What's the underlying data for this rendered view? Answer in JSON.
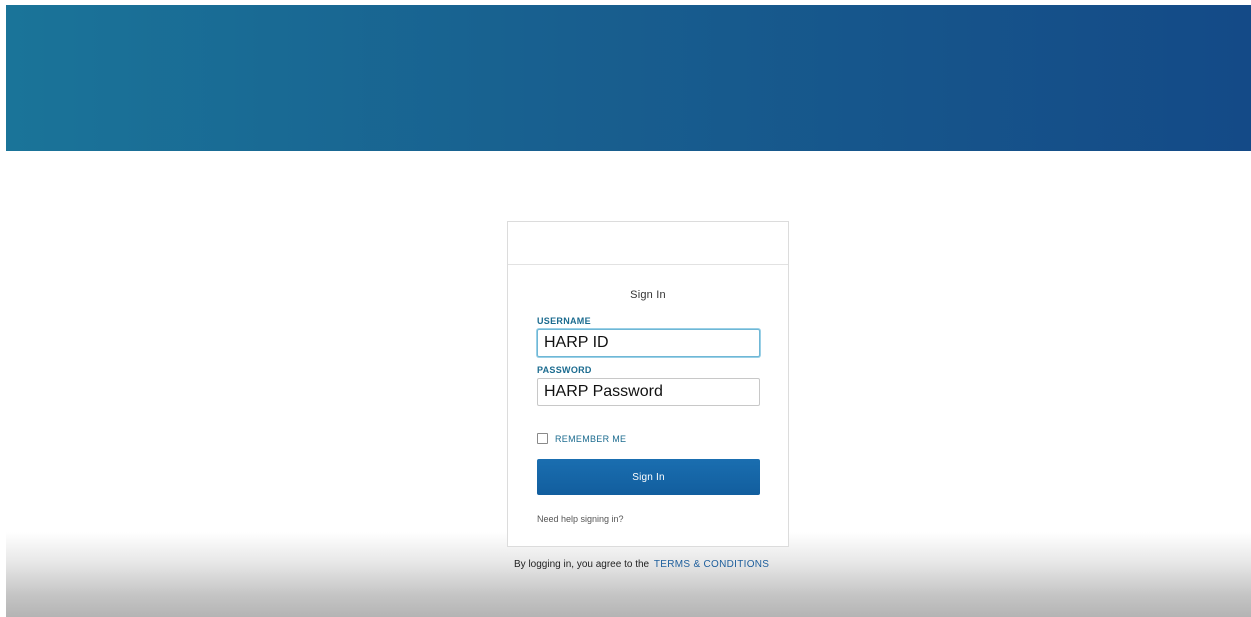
{
  "signin": {
    "title": "Sign In",
    "username_label": "USERNAME",
    "username_value": "HARP ID",
    "password_label": "PASSWORD",
    "password_value": "HARP Password",
    "remember_label": "REMEMBER ME",
    "remember_checked": false,
    "button_label": "Sign In",
    "help_link": "Need help signing in?"
  },
  "footer": {
    "agreement_text": "By logging in, you agree to the",
    "terms_link": "TERMS & CONDITIONS"
  },
  "colors": {
    "banner_start": "#1a7499",
    "banner_end": "#144a87",
    "accent": "#1b6b8f",
    "button": "#1a6eb0",
    "terms_link": "#1d5e9c"
  }
}
